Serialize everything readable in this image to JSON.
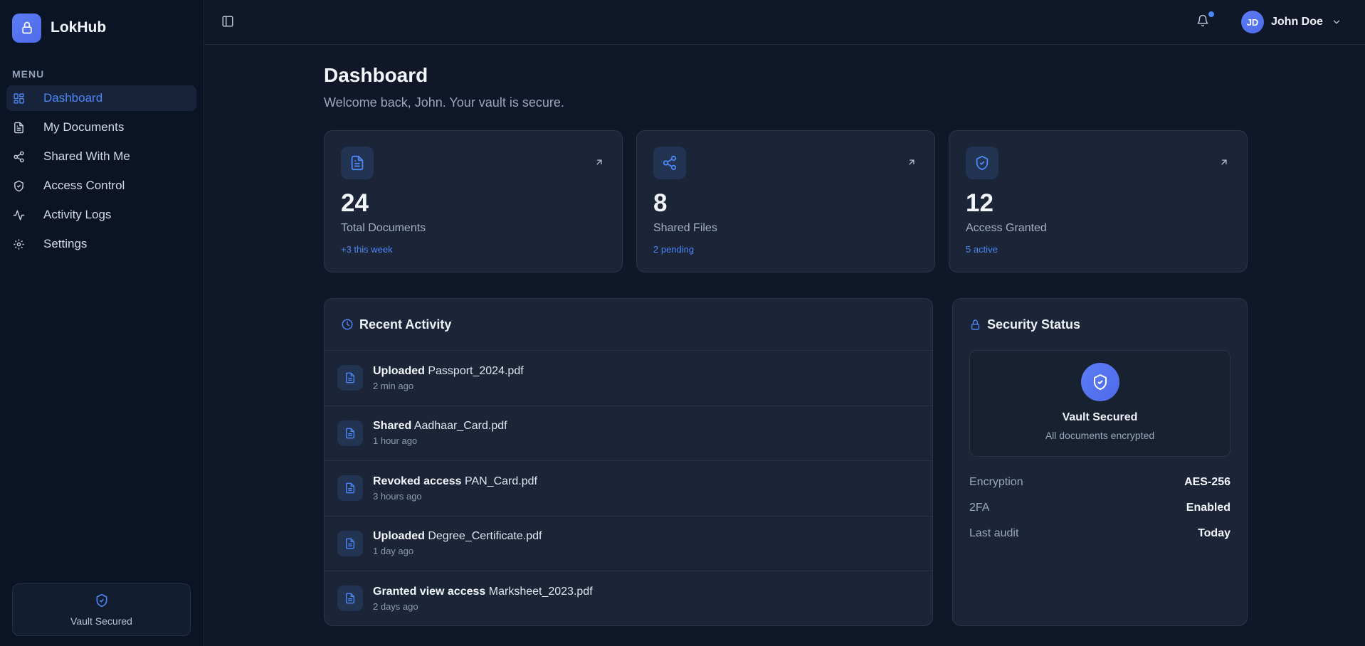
{
  "brand": {
    "name": "LokHub"
  },
  "sidebar": {
    "menu_label": "MENU",
    "items": [
      {
        "label": "Dashboard",
        "icon": "grid-icon",
        "active": true
      },
      {
        "label": "My Documents",
        "icon": "document-icon"
      },
      {
        "label": "Shared With Me",
        "icon": "share-icon"
      },
      {
        "label": "Access Control",
        "icon": "shield-check-icon"
      },
      {
        "label": "Activity Logs",
        "icon": "activity-icon"
      },
      {
        "label": "Settings",
        "icon": "gear-icon"
      }
    ],
    "vault_label": "Vault Secured"
  },
  "topbar": {
    "user_initials": "JD",
    "user_name": "John Doe"
  },
  "page": {
    "title": "Dashboard",
    "subtitle": "Welcome back, John. Your vault is secure."
  },
  "stats": [
    {
      "value": "24",
      "label": "Total Documents",
      "note": "+3 this week",
      "icon": "document-icon"
    },
    {
      "value": "8",
      "label": "Shared Files",
      "note": "2 pending",
      "icon": "share-icon"
    },
    {
      "value": "12",
      "label": "Access Granted",
      "note": "5 active",
      "icon": "shield-check-icon"
    }
  ],
  "activity": {
    "title": "Recent Activity",
    "items": [
      {
        "action": "Uploaded",
        "file": "Passport_2024.pdf",
        "time": "2 min ago"
      },
      {
        "action": "Shared",
        "file": "Aadhaar_Card.pdf",
        "time": "1 hour ago"
      },
      {
        "action": "Revoked access",
        "file": "PAN_Card.pdf",
        "time": "3 hours ago"
      },
      {
        "action": "Uploaded",
        "file": "Degree_Certificate.pdf",
        "time": "1 day ago"
      },
      {
        "action": "Granted view access",
        "file": "Marksheet_2023.pdf",
        "time": "2 days ago"
      }
    ]
  },
  "security": {
    "title": "Security Status",
    "card_title": "Vault Secured",
    "card_sub": "All documents encrypted",
    "rows": [
      {
        "key": "Encryption",
        "value": "AES-256"
      },
      {
        "key": "2FA",
        "value": "Enabled"
      },
      {
        "key": "Last audit",
        "value": "Today"
      }
    ]
  },
  "colors": {
    "accent": "#4d86f5",
    "brand_gradient_start": "#5b7cf7",
    "background": "#0f1729",
    "card": "#1b2537"
  }
}
